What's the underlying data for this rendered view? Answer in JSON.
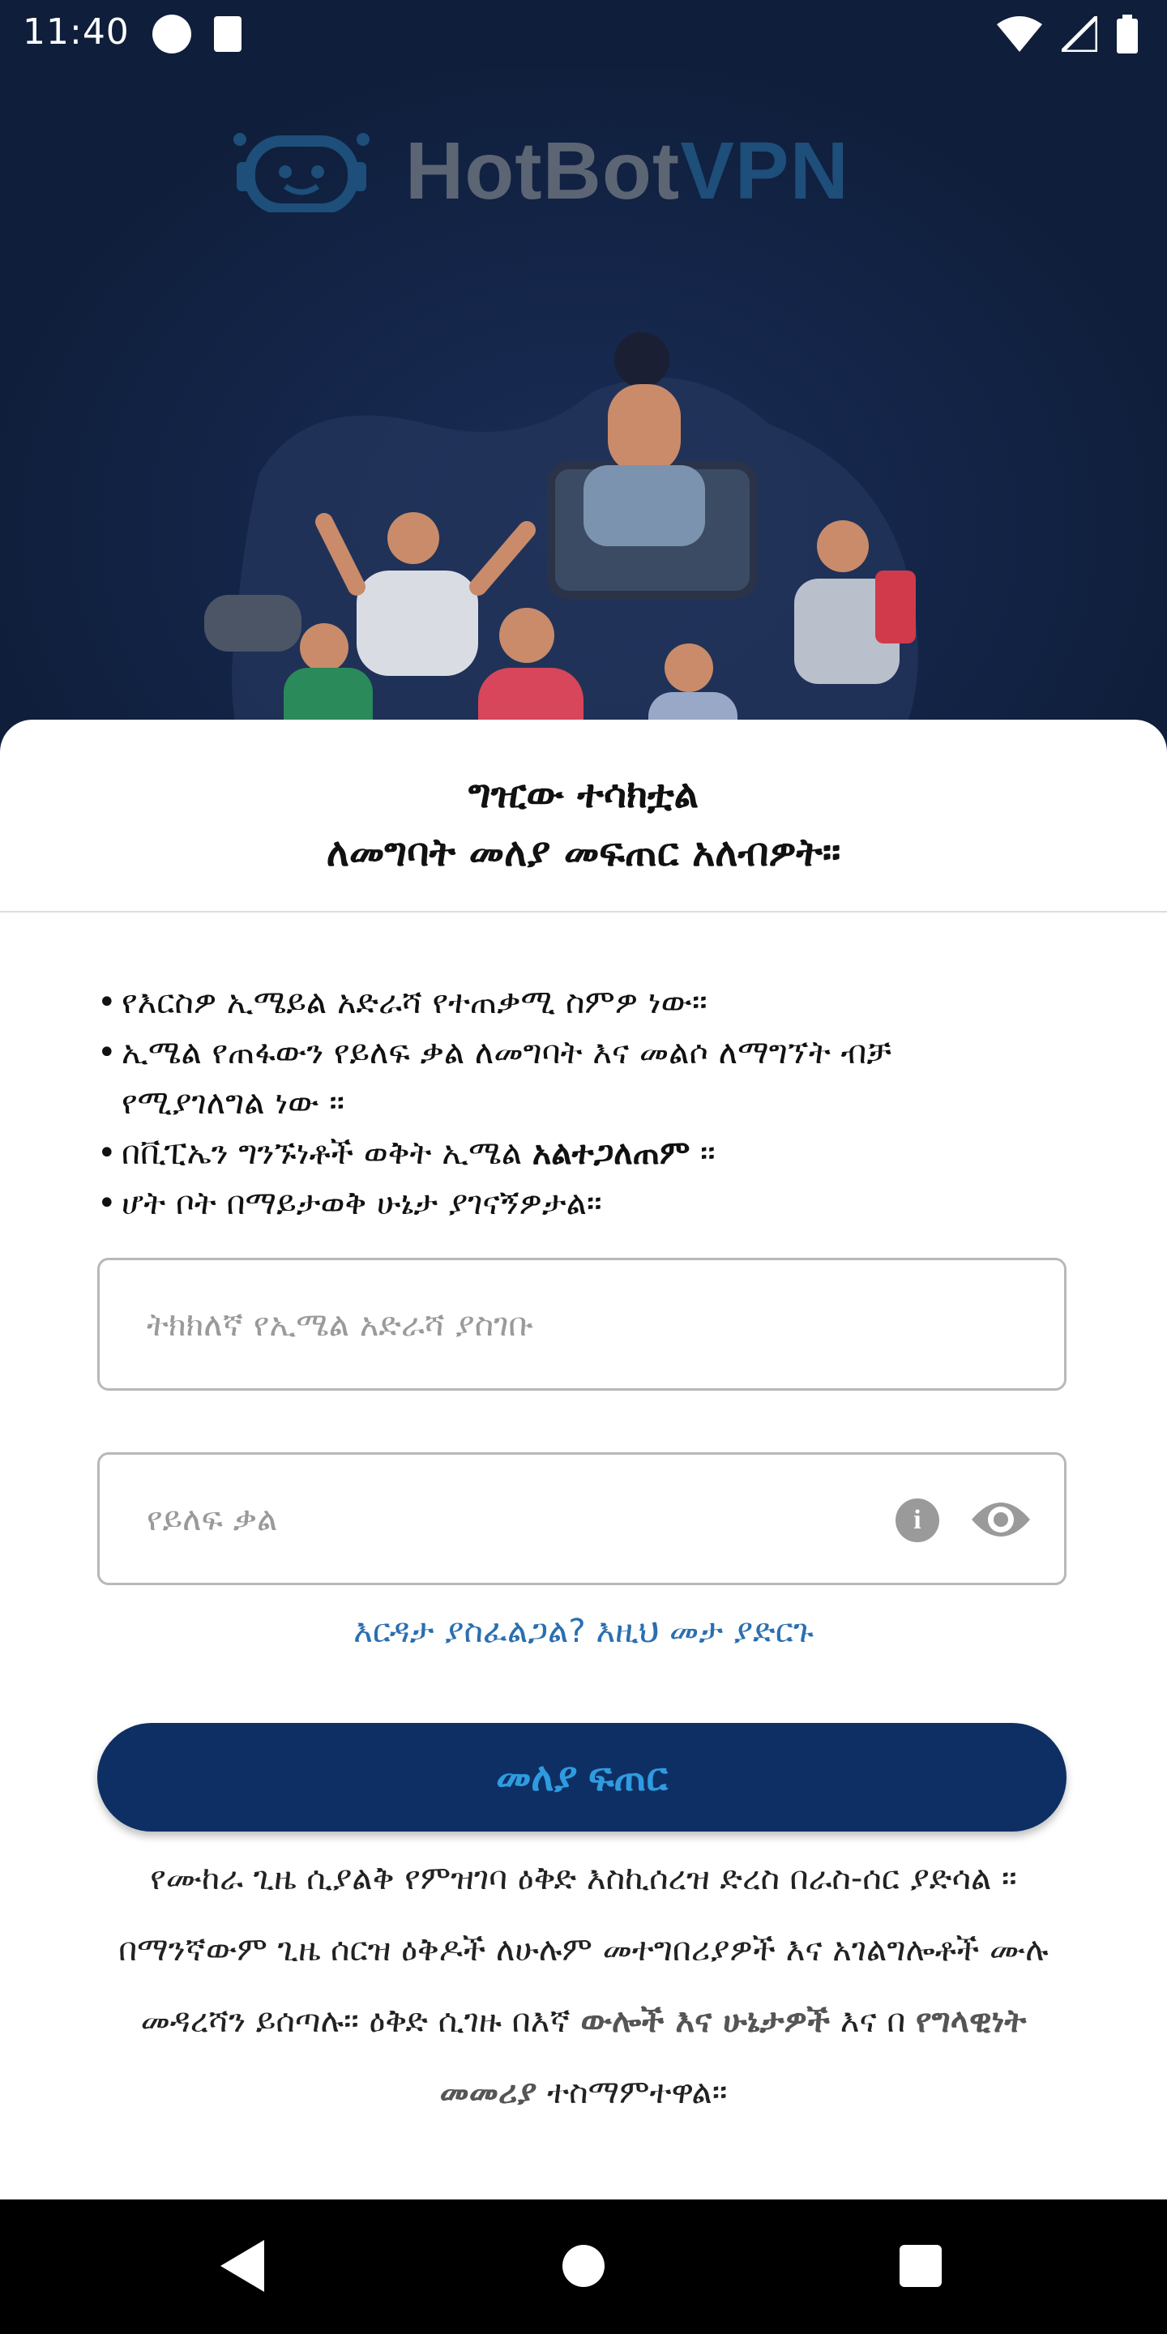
{
  "status_bar": {
    "time": "11:40",
    "icons": [
      "notification-badge-icon",
      "sd-card-icon",
      "wifi-icon",
      "cell-signal-icon",
      "battery-icon"
    ]
  },
  "brand": {
    "logo_text_1": "HotBot",
    "logo_text_2": "VPN",
    "mascot_icon": "robot-face-icon",
    "illustration": "people-chatting-illustration"
  },
  "sheet": {
    "title_line1": "ግዢው ተሳክቷል",
    "title_line2": "ለመግባት መለያ መፍጠር አለብዎት።",
    "bullets": {
      "b1": "የእርስዎ ኢሜይል አድራሻ የተጠቃሚ ስምዎ ነው።",
      "b2_line1": "ኢሜል የጠፋውን የይለፍ ቃል ለመግባት እና መልሶ ለማግኘት ብቻ",
      "b2_line2": "የሚያገለግል ነው ።",
      "b3_pre": "በቪፒኤን ግንኙነቶች ወቅት ኢሜል ",
      "b3_bold": "አልተጋለጠም",
      "b3_post": " ።",
      "b4": "ሆት ቦት በማይታወቅ ሁኔታ ያገናኝዎታል።"
    },
    "email": {
      "value": "",
      "placeholder": "ትክክለኛ የኢሜል አድራሻ ያስገቡ"
    },
    "password": {
      "value": "",
      "placeholder": "የይለፍ ቃል",
      "info_icon": "info-icon",
      "toggle_icon": "eye-icon"
    },
    "help_link": "እርዳታ ያስፈልጋል? እዚህ መታ ያድርጉ",
    "create_button": "መለያ ፍጠር",
    "terms": {
      "text1": "የሙከራ ጊዜ ሲያልቅ የምዝገባ ዕቅድ እስኪሰረዝ ድረስ በራስ-ሰር ያድሳል ። በማንኛውም ጊዜ ሰርዝ ዕቅዶች ለሁሉም መተግበሪያዎች እና አገልግሎቶች ሙሉ መዳረሻን ይሰጣሉ። ዕቅድ ሲገዙ በእኛ ",
      "link1": "ውሎች እና ሁኔታዎች",
      "text2": " እና በ ",
      "link2": "የግላዊነት መመሪያ",
      "text3": " ተስማምተዋል።"
    }
  },
  "nav_bar": {
    "back_icon": "back-triangle-icon",
    "home_icon": "home-circle-icon",
    "recents_icon": "recents-square-icon"
  },
  "colors": {
    "background": "#0f1e3a",
    "primary_button": "#0e2f63",
    "button_text": "#2f9be0",
    "link": "#2a6fb0"
  }
}
